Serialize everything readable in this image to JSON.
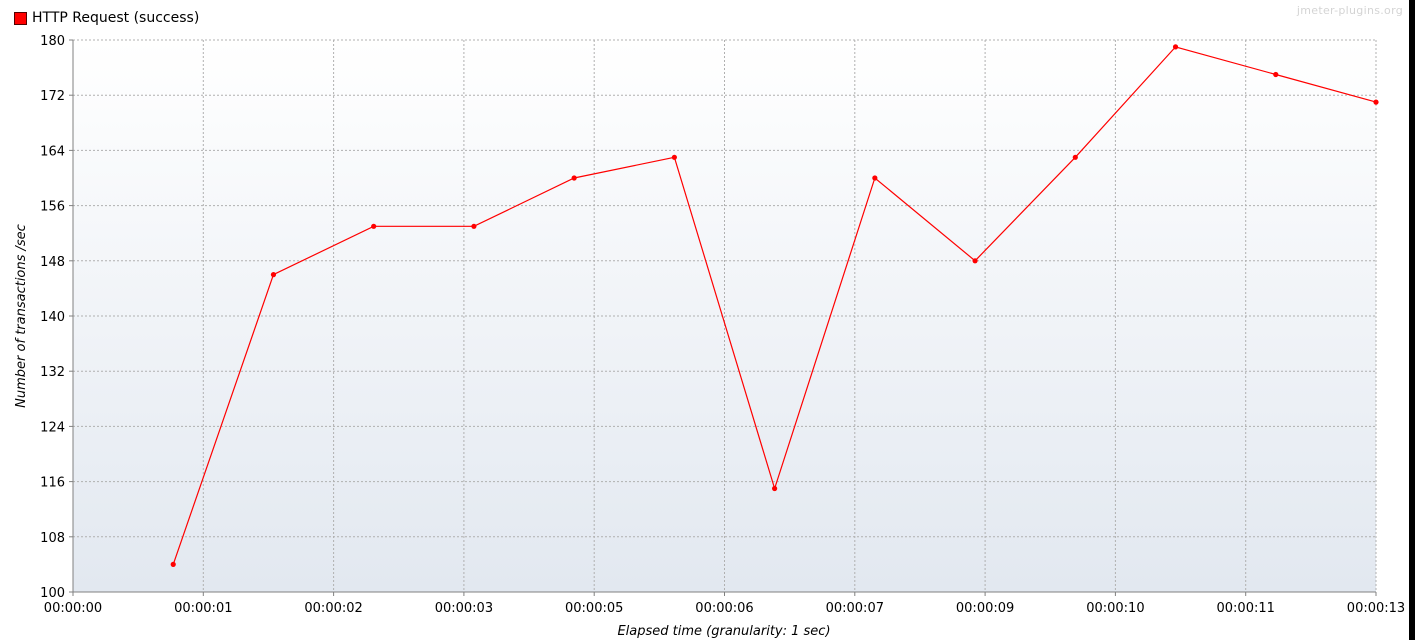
{
  "watermark": "jmeter-plugins.org",
  "colors": {
    "series": "#ff0000",
    "grid": "#b0b0b0",
    "plot_bg_top": "#ffffff",
    "plot_bg_bottom": "#e2e8f0"
  },
  "chart_data": {
    "type": "line",
    "title": "",
    "xlabel": "Elapsed time (granularity: 1 sec)",
    "ylabel": "Number of transactions /sec",
    "ylim": [
      100,
      180
    ],
    "yticks": [
      100,
      108,
      116,
      124,
      132,
      140,
      148,
      156,
      164,
      172,
      180
    ],
    "xlim_seconds": [
      0,
      13
    ],
    "xtick_labels": [
      "00:00:00",
      "00:00:01",
      "00:00:02",
      "00:00:03",
      "00:00:05",
      "00:00:06",
      "00:00:07",
      "00:00:09",
      "00:00:10",
      "00:00:11",
      "00:00:13"
    ],
    "xtick_seconds": [
      0,
      1.3,
      2.6,
      3.9,
      5.2,
      6.5,
      7.8,
      9.1,
      10.4,
      11.7,
      13.0
    ],
    "grid": true,
    "legend_position": "top-left",
    "series": [
      {
        "name": "HTTP Request (success)",
        "color": "#ff0000",
        "x_seconds": [
          1.0,
          2.0,
          3.0,
          4.0,
          5.0,
          6.0,
          7.0,
          8.0,
          9.0,
          10.0,
          11.0,
          12.0,
          13.0
        ],
        "values": [
          104,
          146,
          153,
          153,
          160,
          163,
          115,
          160,
          148,
          163,
          179,
          175,
          171
        ]
      }
    ]
  }
}
